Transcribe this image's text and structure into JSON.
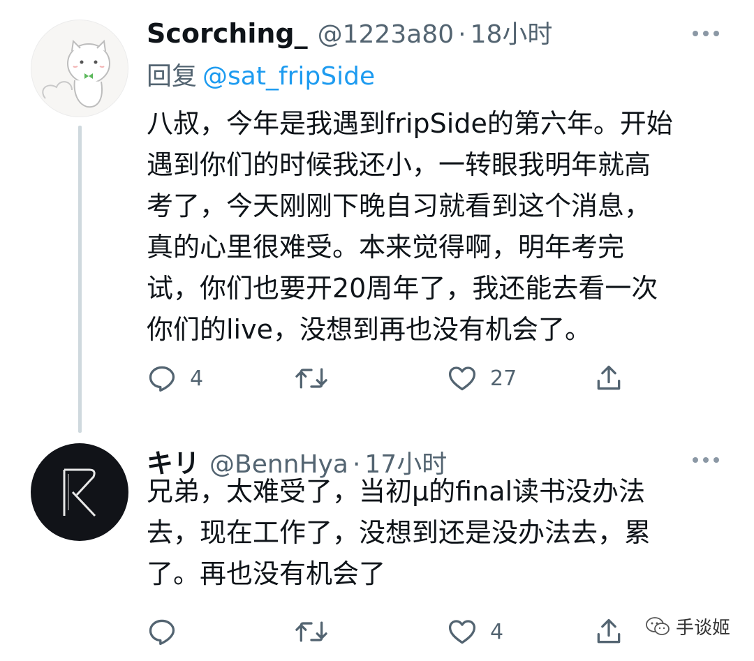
{
  "tweets": [
    {
      "display_name": "Scorching_",
      "handle": "@1223a80",
      "separator": "·",
      "time": "18小时",
      "reply_prefix": "回复",
      "reply_user": "@sat_fripSide",
      "body_lines": [
        "八叔，今年是我遇到fripSide的第六年。开始",
        "遇到你们的时候我还小，一转眼我明年就高",
        "考了，今天刚刚下晚自习就看到这个消息，",
        "真的心里很难受。本来觉得啊，明年考完",
        "试，你们也要开20周年了，我还能去看一次",
        "你们的live，没想到再也没有机会了。"
      ],
      "reply_count": "4",
      "retweet_count": "",
      "like_count": "27"
    },
    {
      "display_name": "キリ",
      "handle": "@BennHya",
      "separator": "·",
      "time": "17小时",
      "body_lines": [
        "兄弟，太难受了，当初μ的final读书没办法",
        "去，现在工作了，没想到还是没办法去，累",
        "了。再也没有机会了"
      ],
      "reply_count": "",
      "retweet_count": "",
      "like_count": "4"
    }
  ],
  "watermark": "手谈姬",
  "icons": {
    "reply": "reply-icon",
    "retweet": "retweet-icon",
    "like": "like-icon",
    "share": "share-icon",
    "more": "more-icon"
  },
  "colors": {
    "text": "#0f1419",
    "secondary": "#536471",
    "link": "#1d9bf0",
    "thread_line": "#cfd9de"
  }
}
